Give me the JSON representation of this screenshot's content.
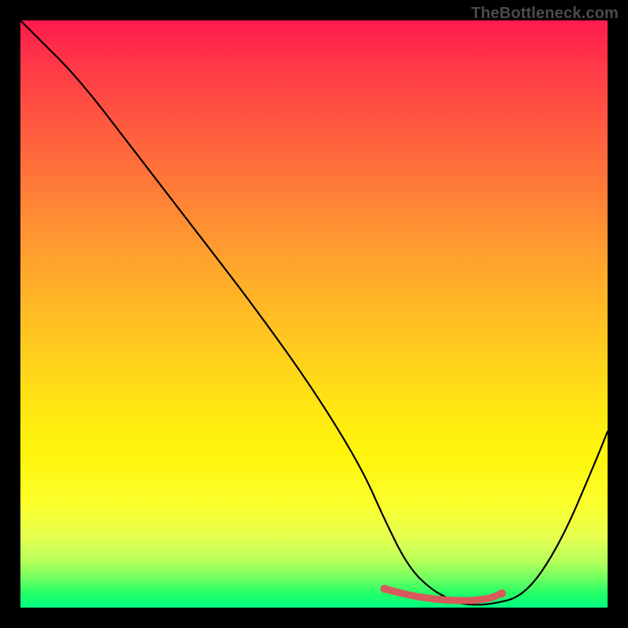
{
  "watermark": "TheBottleneck.com",
  "chart_data": {
    "type": "line",
    "title": "",
    "xlabel": "",
    "ylabel": "",
    "xlim": [
      0,
      100
    ],
    "ylim": [
      0,
      100
    ],
    "grid": false,
    "series": [
      {
        "name": "bottleneck-curve",
        "x": [
          0,
          3,
          10,
          20,
          30,
          40,
          50,
          58,
          62,
          66,
          70,
          74,
          76,
          80,
          86,
          92,
          98,
          100
        ],
        "y": [
          100,
          97,
          90,
          77,
          64,
          51,
          37,
          24,
          15,
          7,
          3,
          1,
          0.5,
          0.5,
          2,
          11,
          25,
          30
        ]
      },
      {
        "name": "minimum-marker",
        "color": "#d85a5a",
        "x": [
          62,
          65,
          68,
          71,
          74,
          77,
          80,
          82
        ],
        "y": [
          3.2,
          2.4,
          1.8,
          1.4,
          1.2,
          1.2,
          1.6,
          2.4
        ]
      }
    ],
    "colors": {
      "background_top": "#ff1a4d",
      "background_bottom": "#00ff80",
      "curve": "#000000",
      "marker": "#d85a5a",
      "frame": "#000000"
    }
  }
}
